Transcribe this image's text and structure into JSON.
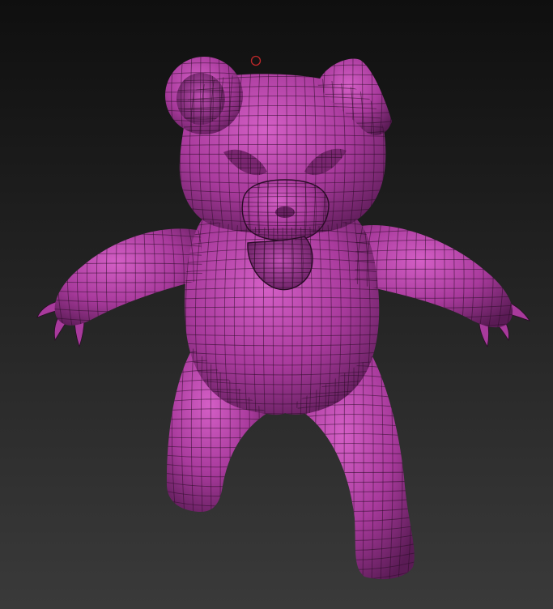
{
  "viewport": {
    "background_top": "#0f0f0f",
    "background_bottom": "#3a3a3a"
  },
  "model": {
    "subject": "teddy-bear",
    "display_mode": "polyframe-wireframe",
    "material_color": "#a83a9c",
    "material_highlight": "#d45fc6",
    "material_shadow": "#5a1b55",
    "wire_color": "#2a0c27"
  },
  "cursor": {
    "icon": "brush-cursor-icon",
    "color": "#c0282a"
  }
}
